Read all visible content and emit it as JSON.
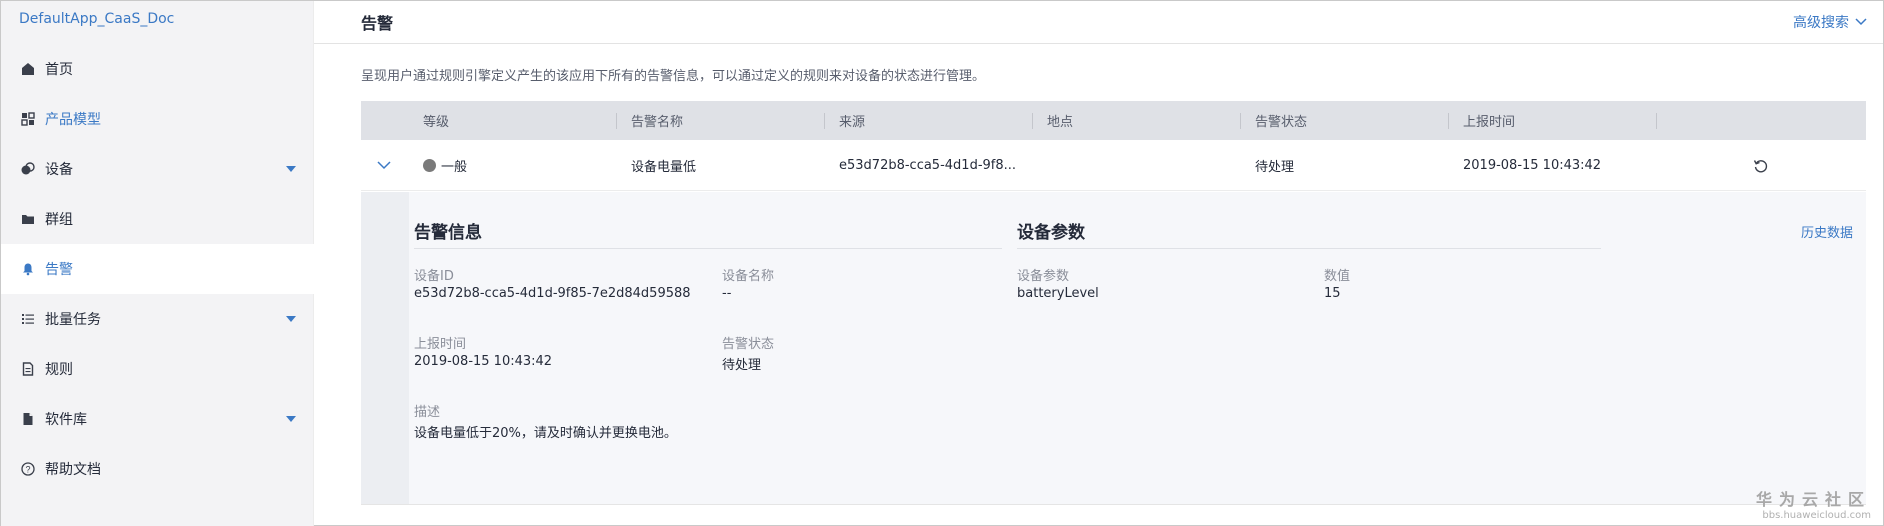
{
  "sidebar": {
    "app_name": "DefaultApp_CaaS_Doc",
    "items": [
      {
        "label": "首页",
        "icon": "home-icon"
      },
      {
        "label": "产品模型",
        "icon": "dashboard-icon"
      },
      {
        "label": "设备",
        "icon": "device-icon",
        "expandable": true
      },
      {
        "label": "群组",
        "icon": "folder-icon"
      },
      {
        "label": "告警",
        "icon": "bell-icon",
        "active": true
      },
      {
        "label": "批量任务",
        "icon": "list-icon",
        "expandable": true
      },
      {
        "label": "规则",
        "icon": "document-icon"
      },
      {
        "label": "软件库",
        "icon": "file-icon",
        "expandable": true
      },
      {
        "label": "帮助文档",
        "icon": "help-icon"
      }
    ]
  },
  "header": {
    "title": "告警",
    "advanced_search": "高级搜索"
  },
  "description": "呈现用户通过规则引擎定义产生的该应用下所有的告警信息，可以通过定义的规则来对设备的状态进行管理。",
  "table": {
    "columns": [
      "等级",
      "告警名称",
      "来源",
      "地点",
      "告警状态",
      "上报时间"
    ],
    "rows": [
      {
        "level": "一般",
        "name": "设备电量低",
        "source": "e53d72b8-cca5-4d1d-9f8...",
        "location": "",
        "status": "待处理",
        "time": "2019-08-15 10:43:42"
      }
    ]
  },
  "detail": {
    "alarm_info_title": "告警信息",
    "device_params_title": "设备参数",
    "history_link": "历史数据",
    "device_id_label": "设备ID",
    "device_id_value": "e53d72b8-cca5-4d1d-9f85-7e2d84d59588",
    "device_name_label": "设备名称",
    "device_name_value": "--",
    "report_time_label": "上报时间",
    "report_time_value": "2019-08-15 10:43:42",
    "alarm_status_label": "告警状态",
    "alarm_status_value": "待处理",
    "desc_label": "描述",
    "desc_value": "设备电量低于20%，请及时确认并更换电池。",
    "param_col_label": "设备参数",
    "value_col_label": "数值",
    "param_name": "batteryLevel",
    "param_value": "15"
  },
  "watermark": {
    "main": "华为云社区",
    "sub": "bbs.huaweicloud.com"
  },
  "colors": {
    "accent": "#3b79c5",
    "sidebar_bg": "#f3f3f5",
    "table_header_bg": "#dfe1e6",
    "level_dot": "#7a7a7a"
  }
}
